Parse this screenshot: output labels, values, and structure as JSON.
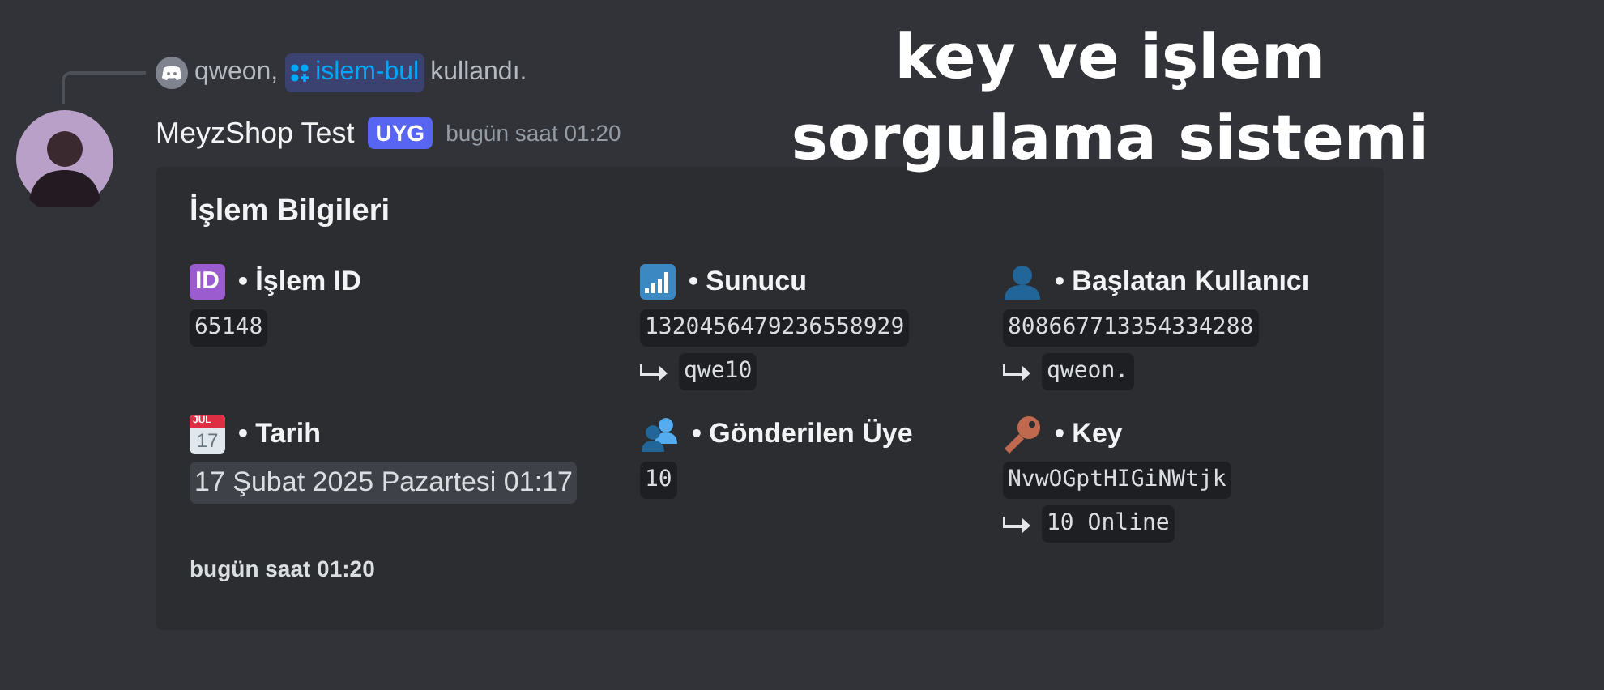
{
  "overlay_title": [
    "key ve işlem",
    "sorgulama sistemi"
  ],
  "reply": {
    "user": "qweon,",
    "command": "islem-bul",
    "suffix": "kullandı."
  },
  "message": {
    "author": "MeyzShop Test",
    "tag": "UYG",
    "time": "bugün saat 01:20"
  },
  "embed": {
    "title": "İşlem Bilgileri",
    "footer": "bugün saat 01:20",
    "fields": [
      {
        "kind": "id",
        "icon_text": [
          "ID"
        ],
        "name": "• İşlem ID",
        "value": "65148"
      },
      {
        "kind": "signal",
        "name": "• Sunucu",
        "value": "1320456479236558929",
        "sub": "qwe10"
      },
      {
        "kind": "person",
        "name": "• Başlatan Kullanıcı",
        "value": "808667713354334288",
        "sub": "qweon."
      },
      {
        "kind": "calendar",
        "icon_text": [
          "JUL",
          "17"
        ],
        "name": "• Tarih",
        "value": "17 Şubat 2025 Pazartesi 01:17"
      },
      {
        "kind": "people",
        "name": "• Gönderilen Üye",
        "value": "10"
      },
      {
        "kind": "key",
        "name": "• Key",
        "value": "NvwOGptHIGiNWtjk",
        "sub": "10 Online"
      }
    ]
  }
}
